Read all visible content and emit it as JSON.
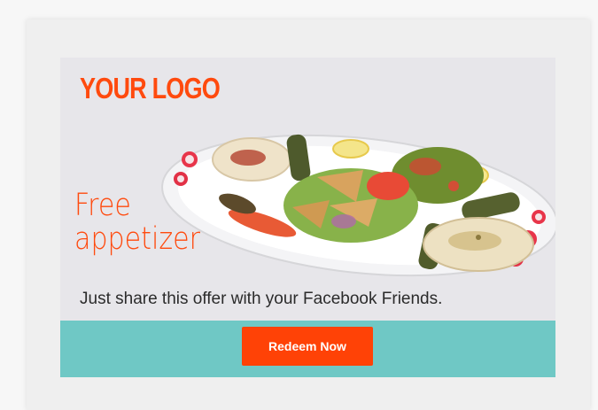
{
  "brand": {
    "logo_text": "YOUR LOGO"
  },
  "offer": {
    "headline_line1": "Free",
    "headline_line2": "appetizer",
    "subtext": "Just share this offer with your Facebook Friends.",
    "button_label": "Redeem Now"
  },
  "colors": {
    "accent": "#ff4a0e",
    "cta_bar": "#6fc8c5",
    "card_bg": "#e7e6ea",
    "button": "#ff4206"
  },
  "image": {
    "icon": "appetizer-platter-image"
  }
}
